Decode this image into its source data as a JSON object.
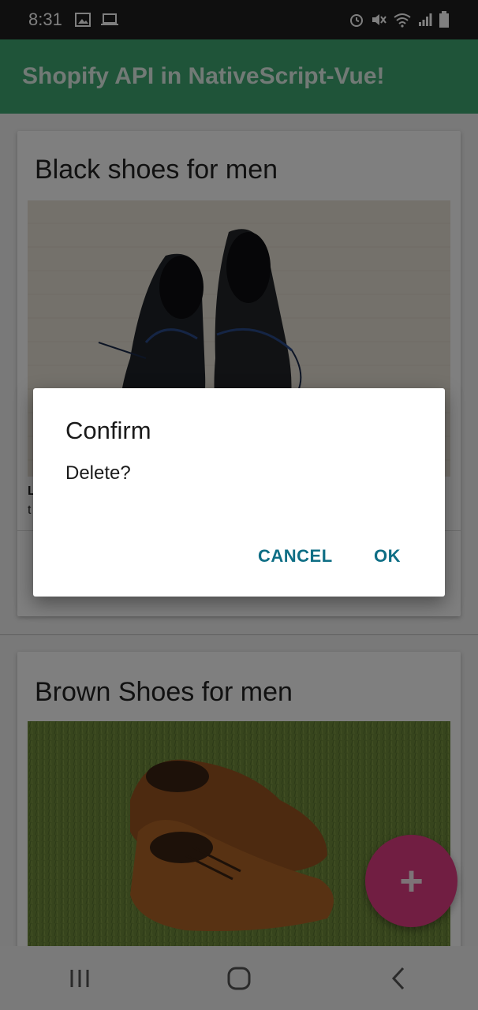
{
  "status_bar": {
    "time": "8:31",
    "left_icons": [
      "image-icon",
      "laptop-icon"
    ],
    "right_icons": [
      "alarm-icon",
      "mute-icon",
      "wifi-icon",
      "signal-icon",
      "battery-icon"
    ]
  },
  "app_bar": {
    "title": "Shopify API in NativeScript-Vue!",
    "color": "#3fa873"
  },
  "products": [
    {
      "title": "Black shoes for men",
      "sub_text_1": "L",
      "sub_text_2": "t"
    },
    {
      "title": "Brown Shoes for men"
    }
  ],
  "fab": {
    "label": "+",
    "color": "#e23c85"
  },
  "dialog": {
    "title": "Confirm",
    "message": "Delete?",
    "cancel_label": "CANCEL",
    "ok_label": "OK",
    "button_color": "#0e6e85"
  },
  "nav_bar": {
    "buttons": [
      "recent-apps-icon",
      "home-icon",
      "back-icon"
    ]
  }
}
